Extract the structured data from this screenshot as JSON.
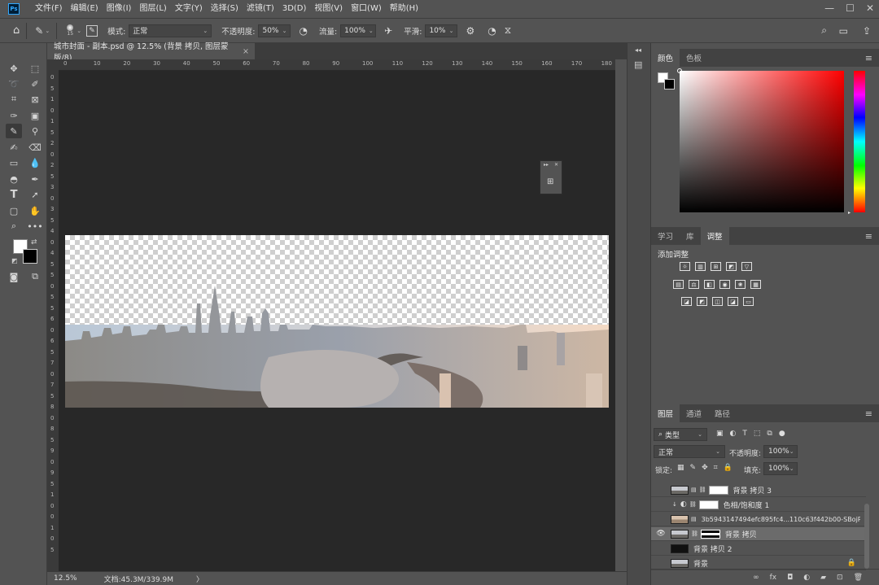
{
  "app": {
    "logo": "Ps"
  },
  "menu": [
    "文件(F)",
    "编辑(E)",
    "图像(I)",
    "图层(L)",
    "文字(Y)",
    "选择(S)",
    "滤镜(T)",
    "3D(D)",
    "视图(V)",
    "窗口(W)",
    "帮助(H)"
  ],
  "window_controls": {
    "minimize": "—",
    "maximize": "☐",
    "close": "✕"
  },
  "options": {
    "brush_size": "15",
    "mode_label": "模式:",
    "mode_value": "正常",
    "opacity_label": "不透明度:",
    "opacity_value": "50%",
    "flow_label": "流量:",
    "flow_value": "100%",
    "smoothing_label": "平滑:",
    "smoothing_value": "10%"
  },
  "document": {
    "tab_title": "城市封面 - 副本.psd @ 12.5% (背景 拷贝, 图层蒙版/8)",
    "close": "×"
  },
  "ruler_top": [
    "0",
    "10",
    "20",
    "30",
    "40",
    "50",
    "60",
    "70",
    "80",
    "90",
    "100",
    "110",
    "120",
    "130",
    "140",
    "150",
    "160",
    "170",
    "180"
  ],
  "ruler_left": [
    "0",
    "5",
    "1",
    "0",
    "1",
    "5",
    "2",
    "0",
    "2",
    "5",
    "3",
    "0",
    "3",
    "5",
    "4",
    "0",
    "4",
    "5",
    "5",
    "0",
    "5",
    "5",
    "6",
    "0",
    "6",
    "5",
    "7",
    "0",
    "7",
    "5",
    "8",
    "0",
    "8",
    "5",
    "9",
    "0",
    "9",
    "5",
    "1",
    "0",
    "0",
    "1",
    "0",
    "5"
  ],
  "status": {
    "zoom": "12.5%",
    "doc": "文档:45.3M/339.9M",
    "arrow": "〉"
  },
  "color_panel": {
    "tabs": [
      "颜色",
      "色板"
    ],
    "active": 0
  },
  "adjust_panel": {
    "tabs": [
      "学习",
      "库",
      "调整"
    ],
    "active": 2,
    "title": "添加调整",
    "row1": [
      "☼",
      "▥",
      "⊞",
      "◩",
      "▽"
    ],
    "row2": [
      "▤",
      "⚖",
      "◧",
      "◉",
      "❀",
      "▦"
    ],
    "row3": [
      "◪",
      "◩",
      "◫",
      "◪",
      "▭"
    ]
  },
  "layers_panel": {
    "tabs": [
      "图层",
      "通道",
      "路径"
    ],
    "active": 0,
    "filter_value": "类型",
    "blend_mode": "正常",
    "opacity_label": "不透明度:",
    "opacity_value": "100%",
    "lock_label": "锁定:",
    "fill_label": "填充:",
    "fill_value": "100%",
    "layers": [
      {
        "name": "背景 拷贝 3",
        "visible": false,
        "mask": true
      },
      {
        "name": "色相/饱和度 1",
        "visible": false,
        "mask": true
      },
      {
        "name": "3b5943147494efc895fc4...110c63f442b00-SBojPM...",
        "visible": false,
        "mask": false
      },
      {
        "name": "背景 拷贝",
        "visible": true,
        "mask": true,
        "selected": true
      },
      {
        "name": "背景 拷贝 2",
        "visible": false,
        "mask": false
      },
      {
        "name": "背景",
        "visible": false,
        "mask": false,
        "locked": true
      }
    ],
    "footer": [
      "∞",
      "fx",
      "◘",
      "◐",
      "▰",
      "⊡",
      "🗑"
    ]
  }
}
